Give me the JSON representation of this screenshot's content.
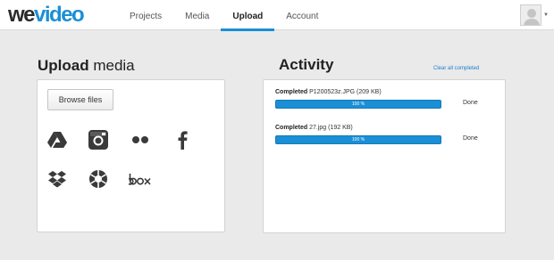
{
  "logo": {
    "part1": "we",
    "part2": "video"
  },
  "nav": {
    "items": [
      {
        "label": "Projects"
      },
      {
        "label": "Media"
      },
      {
        "label": "Upload",
        "active": true
      },
      {
        "label": "Account"
      }
    ]
  },
  "upload": {
    "title_bold": "Upload",
    "title_rest": " media",
    "browse_label": "Browse files",
    "sources": [
      "google-drive",
      "instagram",
      "flickr",
      "facebook",
      "dropbox",
      "picasa",
      "box"
    ]
  },
  "activity": {
    "title": "Activity",
    "clear_label": "Clear all completed",
    "items": [
      {
        "state": "Completed",
        "filename": "P1200523z.JPG (209 KB)",
        "progress": 100,
        "progress_label": "100 %",
        "status": "Done"
      },
      {
        "state": "Completed",
        "filename": "27.jpg (192 KB)",
        "progress": 100,
        "progress_label": "100 %",
        "status": "Done"
      }
    ]
  },
  "colors": {
    "accent": "#1a8fd6",
    "background": "#eaeaea",
    "icon": "#3a3a3a"
  }
}
